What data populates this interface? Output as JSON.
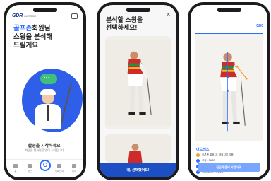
{
  "phone1": {
    "logo": "GDR",
    "logo_sub": "INCTRIBE",
    "greeting_highlight": "골프존",
    "greeting_line1_rest": "회원님",
    "greeting_line2": "스윙을 분석해",
    "greeting_line3": "드릴게요",
    "title": "촬영을 시작하세요.",
    "subtitle": "화면을 탭하면 촬영이 시작됩니다.",
    "tabs": [
      {
        "label": "홈"
      },
      {
        "label": "레슨"
      },
      {
        "label": "기록관리"
      },
      {
        "label": "메뉴"
      }
    ],
    "fab_label": "G"
  },
  "phone2": {
    "title_line1": "분석할 스윙을",
    "title_line2": "선택하세요!",
    "close_icon": "close-icon",
    "cta_label": "네, 선택했어요!"
  },
  "phone3": {
    "page_indicator": "02/0",
    "section_title": "어드레스",
    "checks": [
      {
        "text": "오른쪽 팔꿈치 : 굽혀지지 않음",
        "status": "warn"
      },
      {
        "text": "코킹 : PASS",
        "status": "ok"
      },
      {
        "text": "척추 정렬 : 5초 스윙",
        "status": "ok"
      },
      {
        "text": "어깨 포지션 : PASS",
        "status": "ok"
      }
    ],
    "cta_label": "전단하 준비 되었어요."
  },
  "colors": {
    "brand_blue": "#2b6cff",
    "cta_blue": "#1d4fc4",
    "blob_blue": "#2f5ee8",
    "warn": "#f0a020"
  }
}
